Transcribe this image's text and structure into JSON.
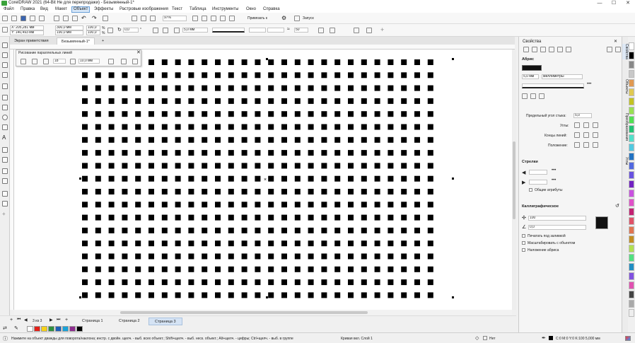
{
  "window": {
    "title": "CorelDRAW 2021 (64-Bit Не для перепродажи) - Безымянный-1*",
    "min": "—",
    "max": "☐",
    "close": "✕"
  },
  "menu": [
    "Файл",
    "Правка",
    "Вид",
    "Макет",
    "Объект",
    "Эффекты",
    "Растровые изображения",
    "Текст",
    "Таблица",
    "Инструменты",
    "Окно",
    "Справка"
  ],
  "menu_active": 4,
  "toolbar": {
    "zoom": "97%",
    "snap": "Привязать к",
    "launch": "Запуск"
  },
  "propbar": {
    "x": "X: 205,281 мм",
    "y": "Y: 140,493 мм",
    "w": "300,0 мм",
    "h": "190,0 мм",
    "sx": "100,0",
    "sy": "100,0",
    "pct": "%",
    "angle": "0,0",
    "angle_unit": "°",
    "outline": "5,0 мм",
    "smooth": "50"
  },
  "tabs": {
    "welcome": "Экран приветствия",
    "doc": "Безымянный-1*",
    "add": "+"
  },
  "floating_toolbar": {
    "title": "Рисование параллельных линий",
    "count": "18",
    "distance": "10,0 мм"
  },
  "pages": {
    "counter": "3 из 3",
    "items": [
      "Страница 1",
      "Страница 2",
      "Страница 3"
    ],
    "active": 2
  },
  "palette": [
    "#ffffff",
    "#e32119",
    "#f7d117",
    "#2f8f3f",
    "#1f5fb6",
    "#1aa3d9",
    "#8d2e8f",
    "#000000"
  ],
  "status": {
    "hint": "Нажмите на объект дважды для поворота/наклона; инстр. с двойн. щелч. - выб. всех объект.; Shift+щелч. - выб. неск. объект.; Alt+щелч. - цифры; Ctrl+щелч. - выб. в группе",
    "layer": "Кривая вкл. Слой 1",
    "fill": "Нет",
    "outline": "C:0 M:0 Y:0 K:100  5,000 мм"
  },
  "docker": {
    "title": "Свойства",
    "outline_section": "Абрис",
    "width": "5,0 мм",
    "units": "миллиметры",
    "miter_label": "Предельный угол стыка:",
    "miter": "5,0",
    "corners_label": "Углы:",
    "caps_label": "Концы линий:",
    "position_label": "Положение:",
    "arrows_section": "Стрелки",
    "shared_attrs": "Общие атрибуты",
    "calligraphy_section": "Каллиграфическое",
    "stretch": "100",
    "angle": "0,0",
    "behind_fill": "Печатать под заливкой",
    "scale_with": "Масштабировать с объектом",
    "overprint": "Наложение абриса"
  },
  "sidetabs": [
    "Свойства",
    "Объекты",
    "Преобразования",
    "Углы"
  ],
  "pattern": {
    "columns": 27,
    "rows": 19
  }
}
